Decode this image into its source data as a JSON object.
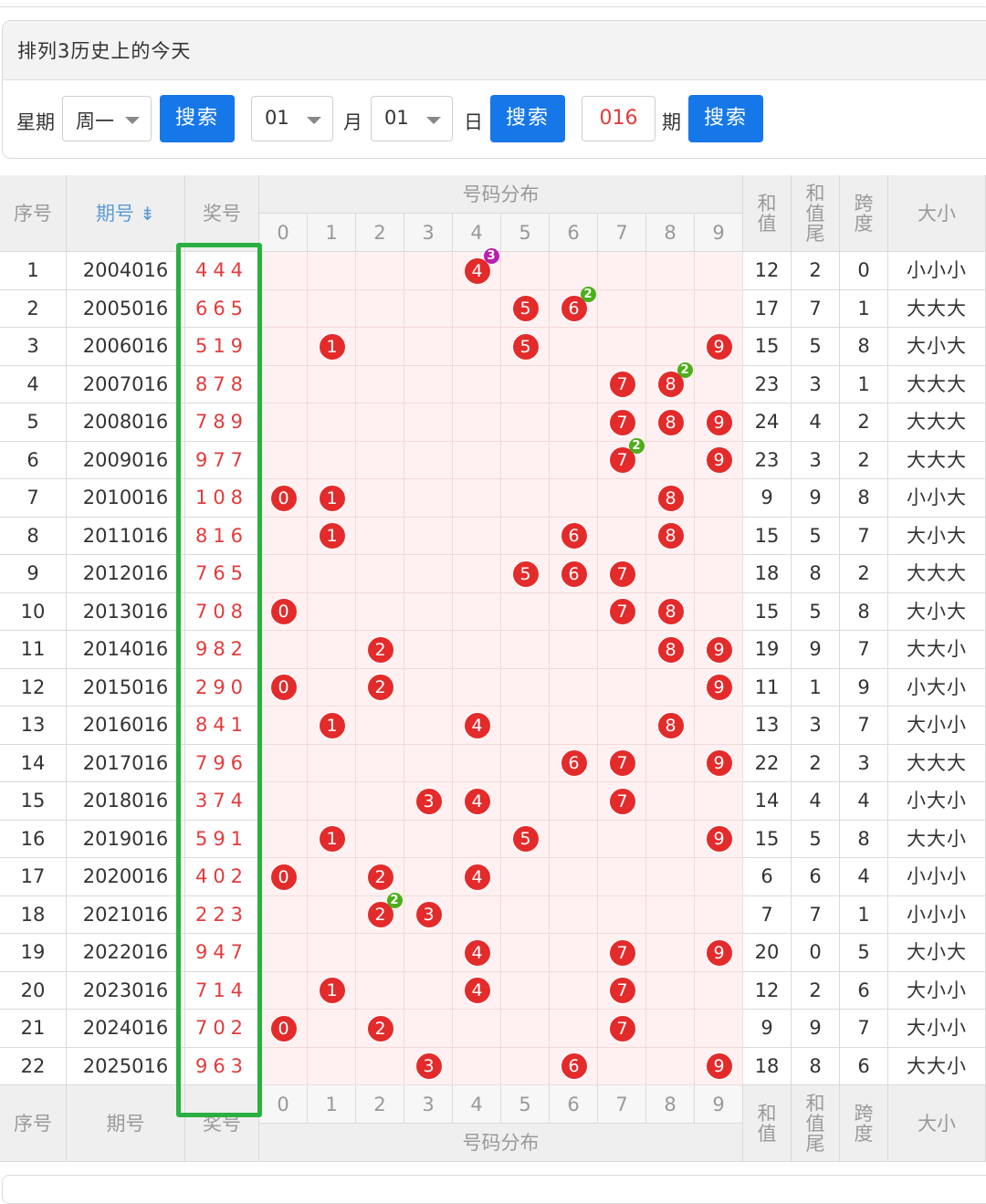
{
  "panel": {
    "title": "排列3历史上的今天",
    "weekday_label": "星期",
    "weekday_value": "周一",
    "month_value": "01",
    "month_label": "月",
    "day_value": "01",
    "day_label": "日",
    "issue_value": "016",
    "issue_label": "期",
    "search_label": "搜索"
  },
  "table": {
    "headers": {
      "index": "序号",
      "issue": "期号",
      "sort_icon": "sort-icon",
      "prize": "奖号",
      "distribution": "号码分布",
      "digits": [
        "0",
        "1",
        "2",
        "3",
        "4",
        "5",
        "6",
        "7",
        "8",
        "9"
      ],
      "sum": "和值",
      "sum_tail": "和值尾",
      "span": "跨度",
      "size": "大小"
    },
    "rows": [
      {
        "idx": "1",
        "issue": "2004016",
        "prize": "444",
        "sum": "12",
        "tail": "2",
        "span": "0",
        "size": "小小小",
        "balls": [
          4
        ],
        "badge": {
          "digit": 4,
          "count": "3",
          "color": "purple"
        }
      },
      {
        "idx": "2",
        "issue": "2005016",
        "prize": "665",
        "sum": "17",
        "tail": "7",
        "span": "1",
        "size": "大大大",
        "balls": [
          5,
          6
        ],
        "badge": {
          "digit": 6,
          "count": "2",
          "color": "green"
        }
      },
      {
        "idx": "3",
        "issue": "2006016",
        "prize": "519",
        "sum": "15",
        "tail": "5",
        "span": "8",
        "size": "大小大",
        "balls": [
          1,
          5,
          9
        ]
      },
      {
        "idx": "4",
        "issue": "2007016",
        "prize": "878",
        "sum": "23",
        "tail": "3",
        "span": "1",
        "size": "大大大",
        "balls": [
          7,
          8
        ],
        "badge": {
          "digit": 8,
          "count": "2",
          "color": "green"
        }
      },
      {
        "idx": "5",
        "issue": "2008016",
        "prize": "789",
        "sum": "24",
        "tail": "4",
        "span": "2",
        "size": "大大大",
        "balls": [
          7,
          8,
          9
        ]
      },
      {
        "idx": "6",
        "issue": "2009016",
        "prize": "977",
        "sum": "23",
        "tail": "3",
        "span": "2",
        "size": "大大大",
        "balls": [
          7,
          9
        ],
        "badge": {
          "digit": 7,
          "count": "2",
          "color": "green"
        }
      },
      {
        "idx": "7",
        "issue": "2010016",
        "prize": "108",
        "sum": "9",
        "tail": "9",
        "span": "8",
        "size": "小小大",
        "balls": [
          0,
          1,
          8
        ]
      },
      {
        "idx": "8",
        "issue": "2011016",
        "prize": "816",
        "sum": "15",
        "tail": "5",
        "span": "7",
        "size": "大小大",
        "balls": [
          1,
          6,
          8
        ]
      },
      {
        "idx": "9",
        "issue": "2012016",
        "prize": "765",
        "sum": "18",
        "tail": "8",
        "span": "2",
        "size": "大大大",
        "balls": [
          5,
          6,
          7
        ]
      },
      {
        "idx": "10",
        "issue": "2013016",
        "prize": "708",
        "sum": "15",
        "tail": "5",
        "span": "8",
        "size": "大小大",
        "balls": [
          0,
          7,
          8
        ]
      },
      {
        "idx": "11",
        "issue": "2014016",
        "prize": "982",
        "sum": "19",
        "tail": "9",
        "span": "7",
        "size": "大大小",
        "balls": [
          2,
          8,
          9
        ]
      },
      {
        "idx": "12",
        "issue": "2015016",
        "prize": "290",
        "sum": "11",
        "tail": "1",
        "span": "9",
        "size": "小大小",
        "balls": [
          0,
          2,
          9
        ]
      },
      {
        "idx": "13",
        "issue": "2016016",
        "prize": "841",
        "sum": "13",
        "tail": "3",
        "span": "7",
        "size": "大小小",
        "balls": [
          1,
          4,
          8
        ]
      },
      {
        "idx": "14",
        "issue": "2017016",
        "prize": "796",
        "sum": "22",
        "tail": "2",
        "span": "3",
        "size": "大大大",
        "balls": [
          6,
          7,
          9
        ]
      },
      {
        "idx": "15",
        "issue": "2018016",
        "prize": "374",
        "sum": "14",
        "tail": "4",
        "span": "4",
        "size": "小大小",
        "balls": [
          3,
          4,
          7
        ]
      },
      {
        "idx": "16",
        "issue": "2019016",
        "prize": "591",
        "sum": "15",
        "tail": "5",
        "span": "8",
        "size": "大大小",
        "balls": [
          1,
          5,
          9
        ]
      },
      {
        "idx": "17",
        "issue": "2020016",
        "prize": "402",
        "sum": "6",
        "tail": "6",
        "span": "4",
        "size": "小小小",
        "balls": [
          0,
          2,
          4
        ]
      },
      {
        "idx": "18",
        "issue": "2021016",
        "prize": "223",
        "sum": "7",
        "tail": "7",
        "span": "1",
        "size": "小小小",
        "balls": [
          2,
          3
        ],
        "badge": {
          "digit": 2,
          "count": "2",
          "color": "green"
        }
      },
      {
        "idx": "19",
        "issue": "2022016",
        "prize": "947",
        "sum": "20",
        "tail": "0",
        "span": "5",
        "size": "大小大",
        "balls": [
          4,
          7,
          9
        ]
      },
      {
        "idx": "20",
        "issue": "2023016",
        "prize": "714",
        "sum": "12",
        "tail": "2",
        "span": "6",
        "size": "大小小",
        "balls": [
          1,
          4,
          7
        ]
      },
      {
        "idx": "21",
        "issue": "2024016",
        "prize": "702",
        "sum": "9",
        "tail": "9",
        "span": "7",
        "size": "大小小",
        "balls": [
          0,
          2,
          7
        ]
      },
      {
        "idx": "22",
        "issue": "2025016",
        "prize": "963",
        "sum": "18",
        "tail": "8",
        "span": "6",
        "size": "大大小",
        "balls": [
          3,
          6,
          9
        ]
      }
    ]
  },
  "colors": {
    "ball": "#e32b2b",
    "prize_text": "#e33b3b",
    "button": "#1677e8",
    "highlight": "#2ab040",
    "zone": "#fff1f1"
  }
}
